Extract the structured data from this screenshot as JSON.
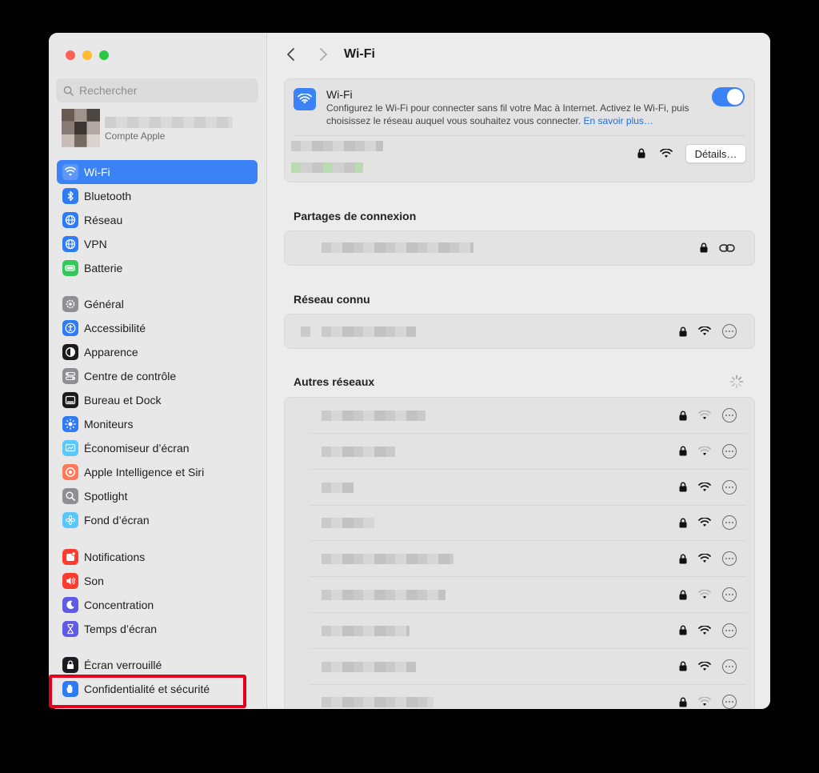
{
  "window": {
    "title": "Wi-Fi"
  },
  "sidebar": {
    "search_placeholder": "Rechercher",
    "account_subtitle": "Compte Apple",
    "items": [
      {
        "label": "Wi-Fi",
        "icon": "wifi-icon",
        "color": "#3b82f6",
        "active": true
      },
      {
        "label": "Bluetooth",
        "icon": "bluetooth-icon",
        "color": "#2f7bf5"
      },
      {
        "label": "Réseau",
        "icon": "globe-icon",
        "color": "#2f7bf5"
      },
      {
        "label": "VPN",
        "icon": "vpn-globe-icon",
        "color": "#2f7bf5"
      },
      {
        "label": "Batterie",
        "icon": "battery-icon",
        "color": "#34c759"
      },
      {
        "label": "Général",
        "icon": "gear-icon",
        "color": "#8e8e93"
      },
      {
        "label": "Accessibilité",
        "icon": "accessibility-icon",
        "color": "#2f7bf5"
      },
      {
        "label": "Apparence",
        "icon": "appearance-icon",
        "color": "#1c1c1e"
      },
      {
        "label": "Centre de contrôle",
        "icon": "control-center-icon",
        "color": "#8e8e93"
      },
      {
        "label": "Bureau et Dock",
        "icon": "dock-icon",
        "color": "#1c1c1e"
      },
      {
        "label": "Moniteurs",
        "icon": "displays-icon",
        "color": "#2f7bf5"
      },
      {
        "label": "Économiseur d’écran",
        "icon": "screensaver-icon",
        "color": "#5ac8fa"
      },
      {
        "label": "Apple Intelligence et Siri",
        "icon": "siri-icon",
        "color": "#ff7a59"
      },
      {
        "label": "Spotlight",
        "icon": "spotlight-icon",
        "color": "#8e8e93"
      },
      {
        "label": "Fond d’écran",
        "icon": "wallpaper-icon",
        "color": "#5ac8fa"
      },
      {
        "label": "Notifications",
        "icon": "notifications-icon",
        "color": "#ff3b30"
      },
      {
        "label": "Son",
        "icon": "sound-icon",
        "color": "#ff3b30"
      },
      {
        "label": "Concentration",
        "icon": "moon-icon",
        "color": "#5e5ce6"
      },
      {
        "label": "Temps d’écran",
        "icon": "hourglass-icon",
        "color": "#5e5ce6"
      },
      {
        "label": "Écran verrouillé",
        "icon": "lock-screen-icon",
        "color": "#1c1c1e"
      },
      {
        "label": "Confidentialité et sécurité",
        "icon": "hand-icon",
        "color": "#2f7bf5"
      }
    ]
  },
  "main": {
    "nav_title": "Wi-Fi",
    "wifi_card": {
      "title": "Wi-Fi",
      "description": "Configurez le Wi-Fi pour connecter sans fil votre Mac à Internet. Activez le Wi-Fi, puis choisissez le réseau auquel vous souhaitez vous connecter.",
      "link": "En savoir plus…",
      "enabled": true,
      "details_label": "Détails…"
    },
    "hotspot_title": "Partages de connexion",
    "known_title": "Réseau connu",
    "others_title": "Autres réseaux",
    "other_networks": [
      {
        "signal": "weak"
      },
      {
        "signal": "weak"
      },
      {
        "signal": "strong"
      },
      {
        "signal": "strong"
      },
      {
        "signal": "strong"
      },
      {
        "signal": "weak"
      },
      {
        "signal": "strong"
      },
      {
        "signal": "strong"
      },
      {
        "signal": "weak"
      }
    ]
  },
  "colors": {
    "accent": "#3b82f6",
    "highlight": "#e4001c"
  }
}
